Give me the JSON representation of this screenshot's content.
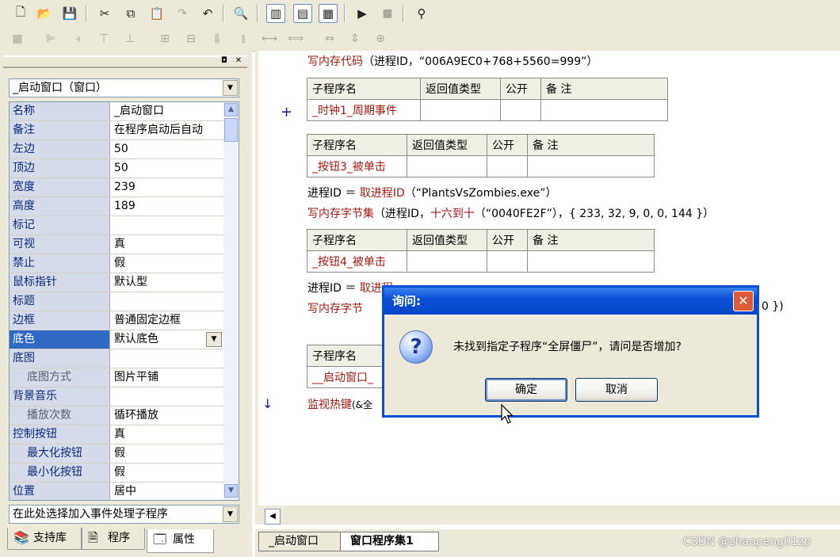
{
  "toolbar1": {
    "icons": [
      "new-file",
      "open-folder",
      "save",
      "cut",
      "copy",
      "paste",
      "redo",
      "undo",
      "find",
      "layout1",
      "layout2",
      "layout3",
      "run",
      "stop",
      "debug-binoculars"
    ]
  },
  "properties_panel": {
    "object_combo": "_启动窗口（窗口）",
    "rows": [
      {
        "name": "名称",
        "value": "_启动窗口"
      },
      {
        "name": "备注",
        "value": "在程序启动后自动"
      },
      {
        "name": "左边",
        "value": "50"
      },
      {
        "name": "顶边",
        "value": "50"
      },
      {
        "name": "宽度",
        "value": "239"
      },
      {
        "name": "高度",
        "value": "189"
      },
      {
        "name": "标记",
        "value": ""
      },
      {
        "name": "可视",
        "value": "真"
      },
      {
        "name": "禁止",
        "value": "假"
      },
      {
        "name": "鼠标指针",
        "value": "默认型"
      },
      {
        "name": "标题",
        "value": ""
      },
      {
        "name": "边框",
        "value": "普通固定边框"
      },
      {
        "name": "底色",
        "value": "默认底色"
      },
      {
        "name": "底图",
        "value": ""
      },
      {
        "name": "底图方式",
        "value": "图片平铺"
      },
      {
        "name": "背景音乐",
        "value": ""
      },
      {
        "name": "播放次数",
        "value": "循环播放"
      },
      {
        "name": "控制按钮",
        "value": "真"
      },
      {
        "name": "最大化按钮",
        "value": "假"
      },
      {
        "name": "最小化按钮",
        "value": "假"
      },
      {
        "name": "位置",
        "value": "居中"
      }
    ],
    "event_combo": "在此处选择加入事件处理子程序",
    "tabs": [
      "支持库",
      "程序",
      "属性"
    ]
  },
  "editor": {
    "line_top": {
      "func": "写内存代码",
      "args": "（进程ID，“006A9EC0+768+5560=999”）"
    },
    "table_headers": [
      "子程序名",
      "返回值类型",
      "公开",
      "备 注"
    ],
    "sub1": "_时钟1_周期事件",
    "sub2": "_按钮3_被单击",
    "line2_var": "进程ID ＝ ",
    "line2_func": "取进程ID",
    "line2_args": "（“PlantsVsZombies.exe”）",
    "line3_func": "写内存字节集",
    "line3_mid": "（进程ID，",
    "line3_func2": "十六到十",
    "line3_args": "（“0040FE2F”），{ 233, 32, 9, 0, 0, 144 }）",
    "sub3": "_按钮4_被单击",
    "line4_var": "进程ID ＝ ",
    "line4_func": "取进程",
    "line5_func": "写内存字节",
    "line5_tail": "0 })",
    "sub4": "__启动窗口_",
    "line6_func": "监视热键",
    "line6_args": "(&全",
    "gutter_plus": "+",
    "gutter_arrow": "↓",
    "tabs": [
      "_启动窗口",
      "窗口程序集1"
    ]
  },
  "dialog": {
    "title": "询问:",
    "message": "未找到指定子程序“全屏僵尸”，请问是否增加?",
    "ok": "确定",
    "cancel": "取消",
    "close": "✕",
    "icon": "?"
  },
  "watermark": "CSDN @zhaopeng01zp"
}
